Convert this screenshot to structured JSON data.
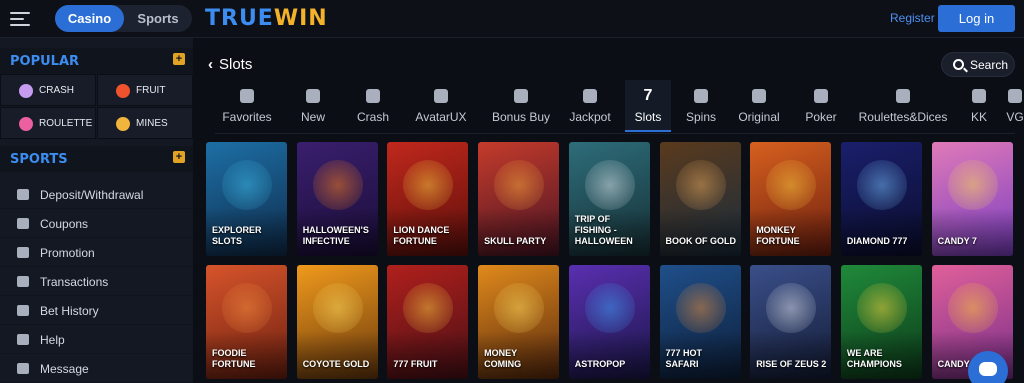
{
  "header": {
    "mode_tabs": [
      "Casino",
      "Sports"
    ],
    "logo": {
      "part1": "TRUE",
      "part2": "WIN"
    },
    "register_label": "Register",
    "login_label": "Log in"
  },
  "sidebar": {
    "popular_title": "POPULAR",
    "sports_title": "SPORTS",
    "games": [
      {
        "label": "CRASH",
        "icon": "rocket-icon",
        "color": "#c59cf0"
      },
      {
        "label": "FRUIT",
        "icon": "seven-icon",
        "color": "#f0522d"
      },
      {
        "label": "ROULETTE",
        "icon": "roulette-icon",
        "color": "#ec5fa1"
      },
      {
        "label": "MINES",
        "icon": "mine-icon",
        "color": "#f1b43c"
      }
    ],
    "items": [
      {
        "label": "Deposit/Withdrawal",
        "icon": "wallet-icon"
      },
      {
        "label": "Coupons",
        "icon": "coupon-icon"
      },
      {
        "label": "Promotion",
        "icon": "gift-icon"
      },
      {
        "label": "Transactions",
        "icon": "transactions-icon"
      },
      {
        "label": "Bet History",
        "icon": "history-icon"
      },
      {
        "label": "Help",
        "icon": "help-icon"
      },
      {
        "label": "Message",
        "icon": "message-icon"
      }
    ]
  },
  "main": {
    "title": "Slots",
    "search_label": "Search",
    "tabs": [
      {
        "label": "Favorites",
        "icon": "star-icon"
      },
      {
        "label": "New",
        "icon": "badge-icon"
      },
      {
        "label": "Crash",
        "icon": "rocket-icon"
      },
      {
        "label": "AvatarUX",
        "icon": "avatarux-icon"
      },
      {
        "label": "Bonus Buy",
        "icon": "bonus-icon"
      },
      {
        "label": "Jackpot",
        "icon": "trophy-icon"
      },
      {
        "label": "Slots",
        "icon": "seven-icon",
        "glyph": "7"
      },
      {
        "label": "Spins",
        "icon": "spin-icon"
      },
      {
        "label": "Original",
        "icon": "original-icon"
      },
      {
        "label": "Poker",
        "icon": "card-icon"
      },
      {
        "label": "Roulettes&Dices",
        "icon": "roulette-icon"
      },
      {
        "label": "KK",
        "icon": "kk-icon"
      },
      {
        "label": "VG",
        "icon": "vg-icon"
      }
    ],
    "active_tab": "Slots",
    "games": [
      {
        "name": "Explorer Slots",
        "color1": "#1d6fa5",
        "color2": "#0f2c4d",
        "accent": "#3bb3e0"
      },
      {
        "name": "Halloween's Infective",
        "color1": "#3a1f6e",
        "color2": "#1a0d38",
        "accent": "#f07a1c"
      },
      {
        "name": "Lion Dance Fortune",
        "color1": "#c0281c",
        "color2": "#5c0f0b",
        "accent": "#f0c23c"
      },
      {
        "name": "Skull Party",
        "color1": "#c43b2b",
        "color2": "#4a1424",
        "accent": "#f0a33c"
      },
      {
        "name": "Trip of Fishing -Halloween",
        "color1": "#2d6d7a",
        "color2": "#173036",
        "accent": "#d7e0e6"
      },
      {
        "name": "Book of Gold",
        "color1": "#5a3a1d",
        "color2": "#1a2c3c",
        "accent": "#e0a35a"
      },
      {
        "name": "Monkey Fortune",
        "color1": "#d6601f",
        "color2": "#6e1f0f",
        "accent": "#f5c23c"
      },
      {
        "name": "Diamond 777",
        "color1": "#1a1f6b",
        "color2": "#0a0d2e",
        "accent": "#6fb5f0"
      },
      {
        "name": "Candy 7",
        "color1": "#e07ab8",
        "color2": "#7a3ec2",
        "accent": "#f5d35c"
      },
      {
        "name": "Foodie Fortune",
        "color1": "#d6542b",
        "color2": "#6e2010",
        "accent": "#f08a3c"
      },
      {
        "name": "Coyote Gold",
        "color1": "#f09a1c",
        "color2": "#6b3a0d",
        "accent": "#f5d35c"
      },
      {
        "name": "777 Fruit",
        "color1": "#b0201c",
        "color2": "#4a0f16",
        "accent": "#f0c23c"
      },
      {
        "name": "Money Coming",
        "color1": "#e08a1c",
        "color2": "#5a2a0d",
        "accent": "#f5d35c"
      },
      {
        "name": "Astropop",
        "color1": "#5a2fb0",
        "color2": "#1a1648",
        "accent": "#3c9bf0"
      },
      {
        "name": "777 Hot Safari",
        "color1": "#1f4f8a",
        "color2": "#0d1f3a",
        "accent": "#e08a3c"
      },
      {
        "name": "Rise of Zeus 2",
        "color1": "#3a4f8a",
        "color2": "#141c36",
        "accent": "#d7dce6"
      },
      {
        "name": "We Are Champions",
        "color1": "#1f8a3a",
        "color2": "#0d3a1a",
        "accent": "#f0d23c"
      },
      {
        "name": "Candy Fiesta",
        "color1": "#e0609a",
        "color2": "#7a2f8a",
        "accent": "#f5c23c"
      }
    ]
  }
}
